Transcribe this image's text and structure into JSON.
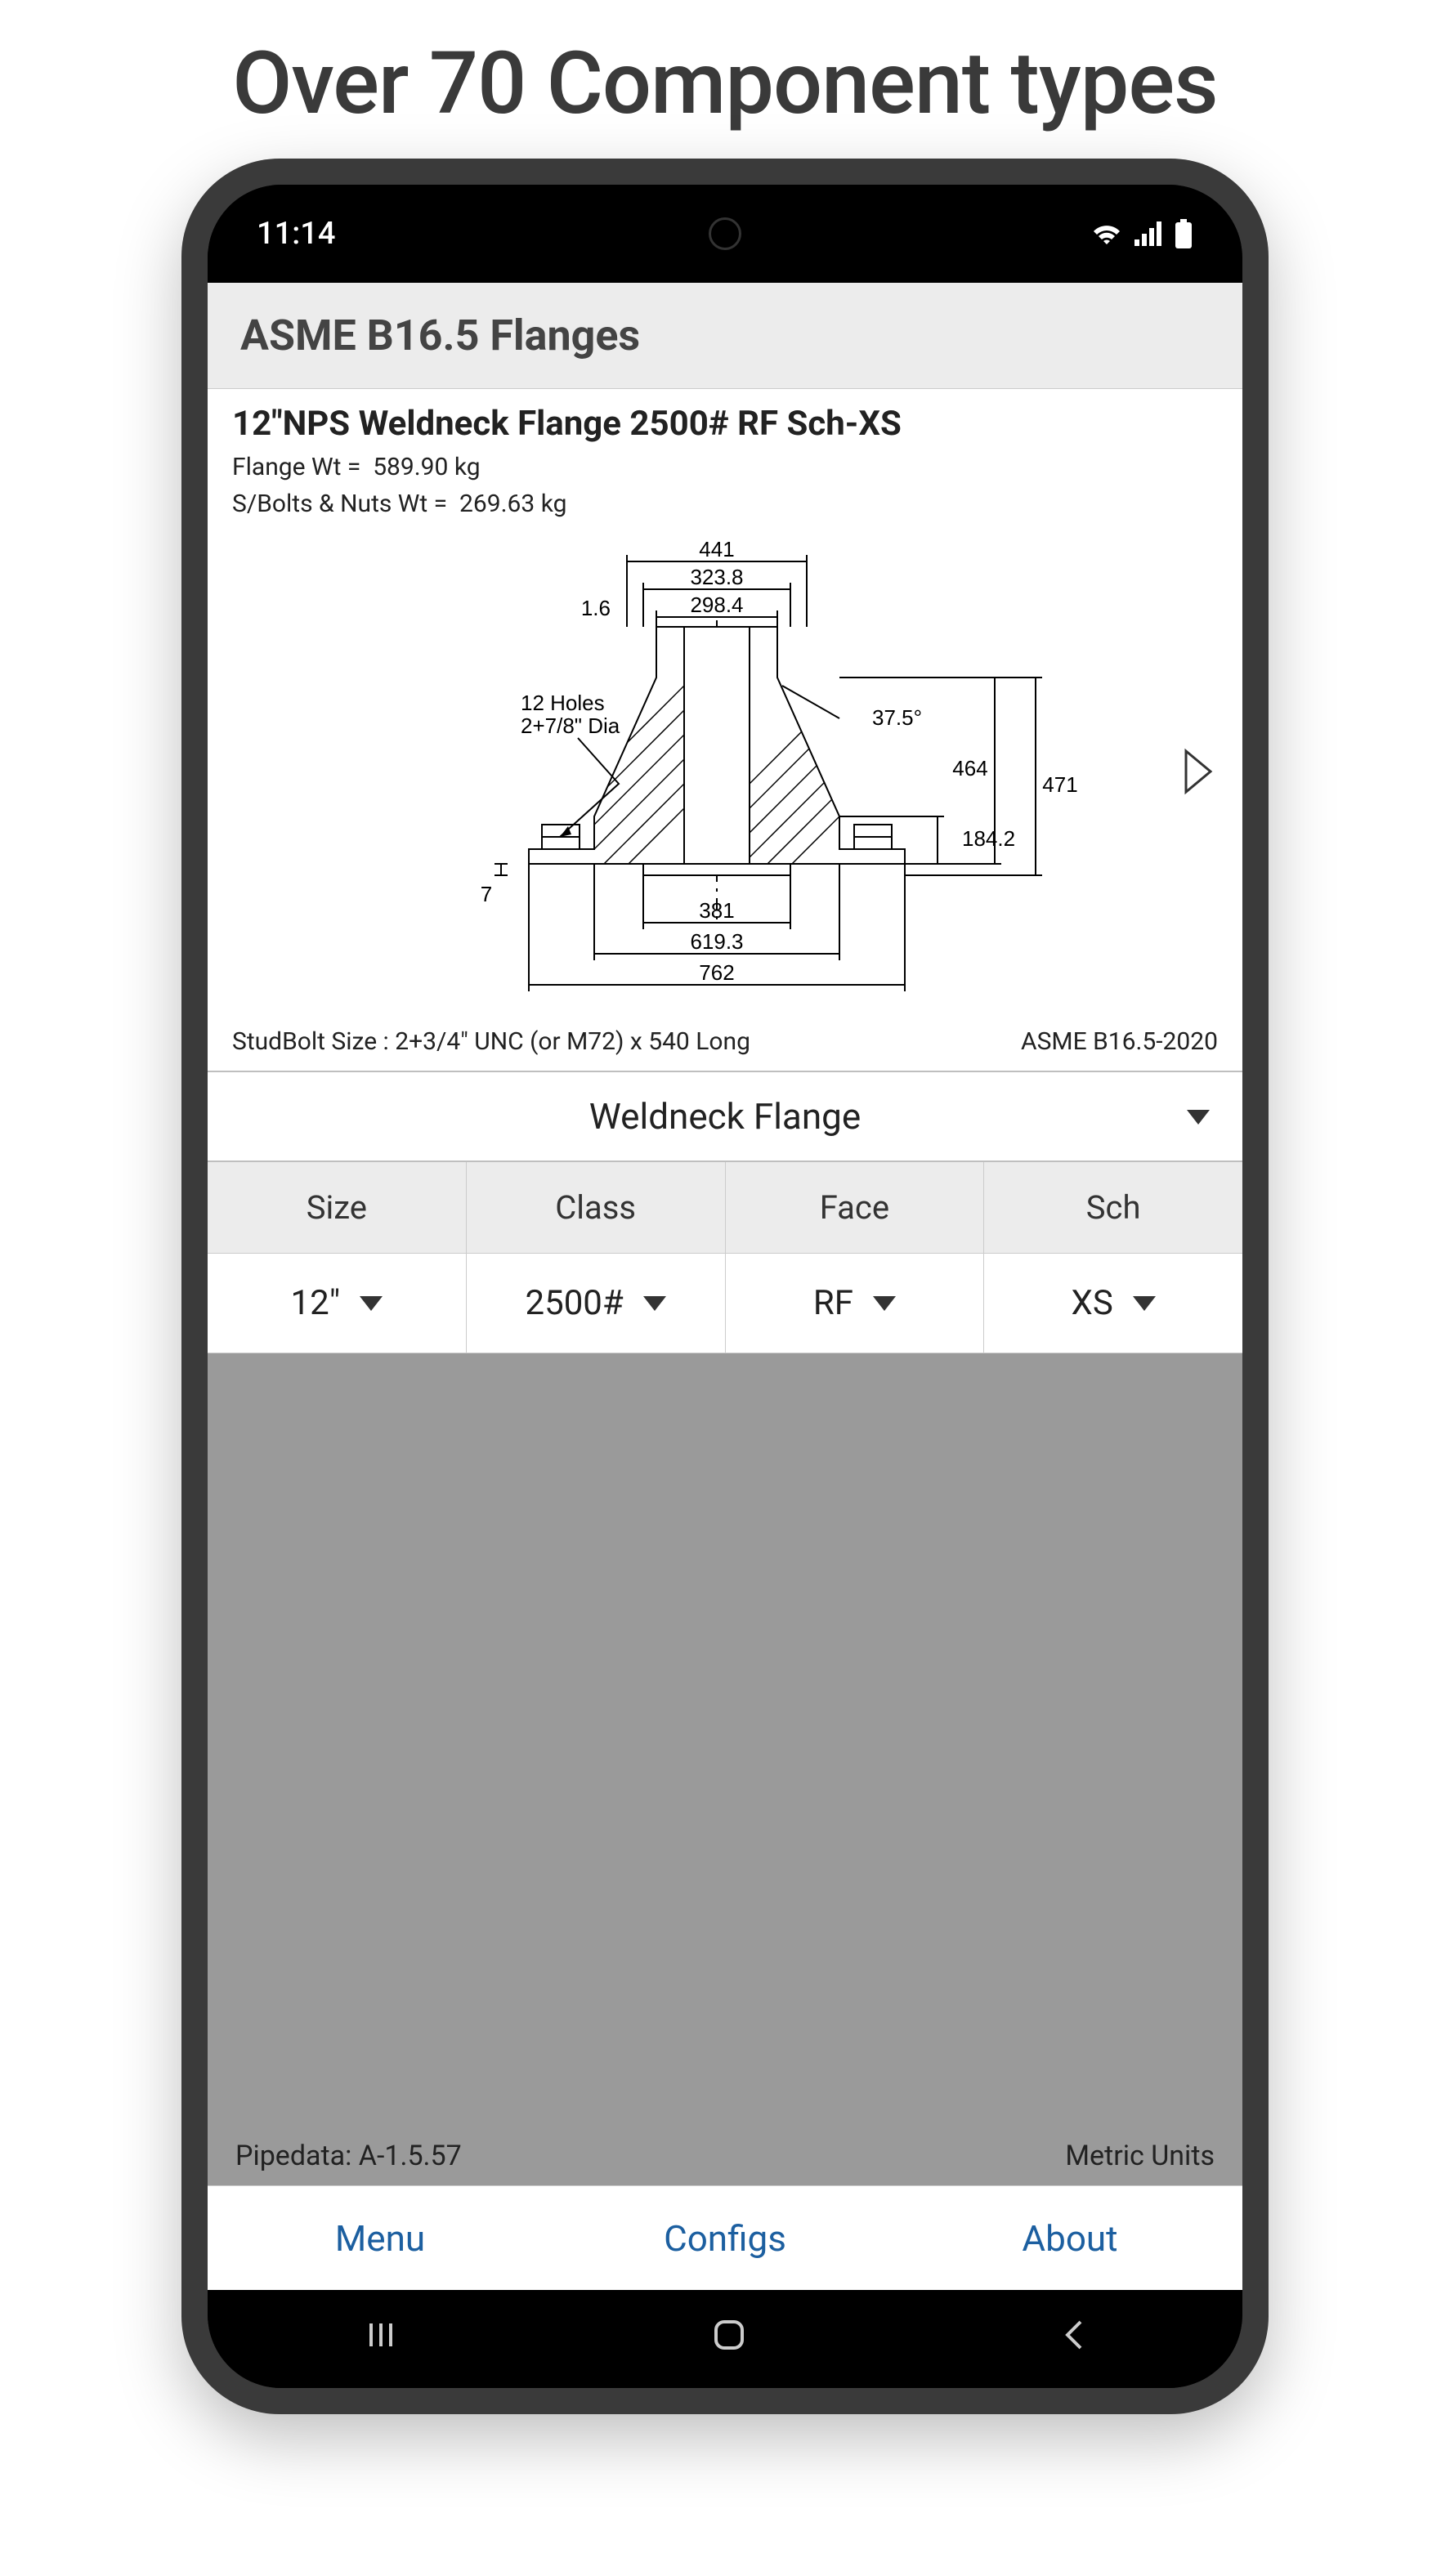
{
  "hero": {
    "title": "Over 70 Component types"
  },
  "status": {
    "time": "11:14"
  },
  "header": {
    "title": "ASME B16.5 Flanges"
  },
  "spec": {
    "title": "12\"NPS Weldneck Flange 2500# RF Sch-XS",
    "flange_wt_label": "Flange Wt =",
    "flange_wt_value": "589.90 kg",
    "bolts_wt_label": "S/Bolts & Nuts Wt =",
    "bolts_wt_value": "269.63 kg",
    "studbolt": "StudBolt Size : 2+3/4\" UNC  (or M72)  x 540 Long",
    "standard": "ASME B16.5-2020"
  },
  "diagram": {
    "dims": {
      "top1": "441",
      "top2": "323.8",
      "top3": "298.4",
      "left_gap": "1.6",
      "holes_line1": "12 Holes",
      "holes_line2": "2+7/8\" Dia",
      "angle": "37.5°",
      "right1": "464",
      "right2": "471",
      "right3": "184.2",
      "bottom_left": "7",
      "bot1": "381",
      "bot2": "619.3",
      "bot3": "762"
    }
  },
  "type_dropdown": {
    "value": "Weldneck Flange"
  },
  "params": {
    "cols": [
      {
        "head": "Size",
        "value": "12\""
      },
      {
        "head": "Class",
        "value": "2500#"
      },
      {
        "head": "Face",
        "value": "RF"
      },
      {
        "head": "Sch",
        "value": "XS"
      }
    ]
  },
  "grey_footer": {
    "version": "Pipedata: A-1.5.57",
    "units": "Metric Units"
  },
  "tabs": {
    "menu": "Menu",
    "configs": "Configs",
    "about": "About"
  }
}
